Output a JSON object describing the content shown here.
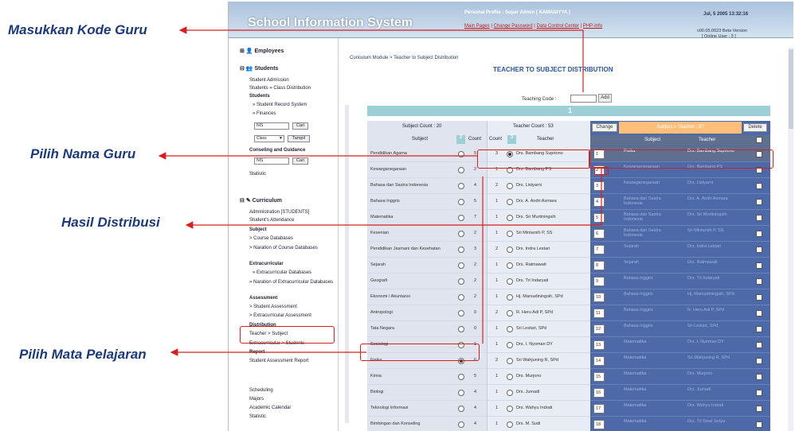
{
  "annotations": {
    "kode_guru": "Masukkan Kode Guru",
    "nama_guru": "Pilih Nama Guru",
    "hasil": "Hasil Distribusi",
    "mapel": "Pilih Mata Pelajaran"
  },
  "header": {
    "title": "School Information System",
    "profile": "Personal Profile : Super Admin [ KAMADIYYA ]",
    "links": [
      "Main Pages",
      "Change Password",
      "Data Control Center",
      "PHP-Info"
    ],
    "clock": "Jul, 5 2005 13:32:16",
    "version": "v00.05.0623 Beta Version",
    "online": "[ Online User : 3 ]"
  },
  "sidebar": {
    "employees": "Employees",
    "students": "Students",
    "student_admission": "Student Admission",
    "class_distribution": "Students » Class Distribution",
    "students_sub": "Students",
    "record_system": "» Student Record System",
    "finances": "» Finances",
    "nis1": "NIS",
    "cari1": "Cari",
    "class_sel": "Class",
    "tampil": "Tampil",
    "conseling": "Conseling and Guidance",
    "nis2": "NIS",
    "cari2": "Cari",
    "statistic": "Statistic",
    "curriculum": "Curriculum",
    "administration": "Administration [STUDENTS]",
    "attendance": "Student's Attendance",
    "subject": "Subject",
    "course_db": "> Course Databases",
    "narration_course": "> Naration of Course Databases",
    "extracurricular": "Extracurricular",
    "extra_db": "» Extracurricular Databases",
    "narration_extra": "» Naration of Extracurricular Databases",
    "assessment": "Assessment",
    "student_assessment": "> Student Assessment",
    "extra_assessment": "> Extracurricular Assessment",
    "distribution": "Distribution",
    "teacher_subject": "Teacher > Subject",
    "extra_students": "Extracurricular > Students",
    "report": "Report",
    "assessment_report": "Student Assessment Report",
    "scheduling": "Scheduling",
    "majors": "Majors",
    "academic_calendar": "Academic Calendar",
    "statistic2": "Statistic"
  },
  "main": {
    "breadcrumb": "Curiculum Module > Teacher to Subject Distribution",
    "page_title": "TEACHER TO SUBJECT DISTRIBUTION",
    "teaching_code_label": "Teaching Code :",
    "add_label": "Add",
    "band_number": "1",
    "subject_count": "Subject Count : 20",
    "teacher_count": "Teacher Count : 53",
    "col_subject": "Subject",
    "col_count": "Count",
    "col_teacher": "Teacher",
    "step2": "2",
    "step3": "3",
    "change_label": "Change",
    "dist_header": "Subject » Teacher : 87",
    "delete_label": "Delete",
    "dist_col_subject": "Subject",
    "dist_col_teacher": "Teacher"
  },
  "subjects": [
    {
      "name": "Pendidikan Agama",
      "count": "5"
    },
    {
      "name": "Kewarganegaraan",
      "count": "2"
    },
    {
      "name": "Bahasa dan Sastra Indonesia",
      "count": "4"
    },
    {
      "name": "Bahasa Inggris",
      "count": "5"
    },
    {
      "name": "Matematika",
      "count": "7"
    },
    {
      "name": "Kesenian",
      "count": "2"
    },
    {
      "name": "Pendidikan Jasmani dan Kesehatan",
      "count": "3"
    },
    {
      "name": "Sejarah",
      "count": "2"
    },
    {
      "name": "Geografi",
      "count": "2"
    },
    {
      "name": "Ekonomi / Akuntansi",
      "count": "2"
    },
    {
      "name": "Antropologi",
      "count": "0"
    },
    {
      "name": "Tata Negara",
      "count": "0"
    },
    {
      "name": "Sosiologi",
      "count": "1"
    },
    {
      "name": "Fisika",
      "count": "6"
    },
    {
      "name": "Kimia",
      "count": "5"
    },
    {
      "name": "Biologi",
      "count": "4"
    },
    {
      "name": "Teknologi Informasi",
      "count": "4"
    },
    {
      "name": "Bimbingan dan Konseling",
      "count": "4"
    },
    {
      "name": "Bahasa Jepang",
      "count": "1"
    }
  ],
  "teachers": [
    {
      "count": "3",
      "name": "Drs. Bambang Supriono"
    },
    {
      "count": "1",
      "name": "Drs. Bambang PS"
    },
    {
      "count": "2",
      "name": "Drs. Listyarni"
    },
    {
      "count": "1",
      "name": "Drs. A. Andri Asmara"
    },
    {
      "count": "1",
      "name": "Drs. Sri Murtiningsih"
    },
    {
      "count": "1",
      "name": "Sri Mintarsih P, SS"
    },
    {
      "count": "2",
      "name": "Drs. Indra Lestari"
    },
    {
      "count": "1",
      "name": "Drs. Ratmawati"
    },
    {
      "count": "1",
      "name": "Drs. Tri Indaryati"
    },
    {
      "count": "1",
      "name": "Hj. Marsudiningsih, SPd"
    },
    {
      "count": "2",
      "name": "R. Heru Adi P, SPd"
    },
    {
      "count": "1",
      "name": "Sri Lestari, SPd"
    },
    {
      "count": "1",
      "name": "Drs. I. Nyoman DY"
    },
    {
      "count": "2",
      "name": "Sri Wahjuning R, SPd"
    },
    {
      "count": "1",
      "name": "Drs. Murjono"
    },
    {
      "count": "1",
      "name": "Drs. Jumadi"
    },
    {
      "count": "1",
      "name": "Drs. Wahyu Indrati"
    },
    {
      "count": "1",
      "name": "Drs. M. Sudi"
    },
    {
      "count": "1",
      "name": "Drs. Rahadiya"
    }
  ],
  "distribution": [
    {
      "no": "1",
      "subject": "Fisika",
      "teacher": "Drs. Bambang Supriono"
    },
    {
      "no": "2",
      "subject": "Kewarganegaraan",
      "teacher": "Drs. Bambang PS"
    },
    {
      "no": "3",
      "subject": "Kewarganegaraan",
      "teacher": "Drs. Listyarni"
    },
    {
      "no": "4",
      "subject": "Bahasa dan Sastra Indonesia",
      "teacher": "Drs. A. Andri Asmara"
    },
    {
      "no": "5",
      "subject": "Bahasa dan Sastra Indonesia",
      "teacher": "Drs. Sri Murtiningsih"
    },
    {
      "no": "6",
      "subject": "Bahasa dan Sastra Indonesia",
      "teacher": "Sri Mintarsih P, SS"
    },
    {
      "no": "7",
      "subject": "Sejarah",
      "teacher": "Drs. Indra Lestari"
    },
    {
      "no": "8",
      "subject": "Sejarah",
      "teacher": "Drs. Ratmawati"
    },
    {
      "no": "9",
      "subject": "Bahasa Inggris",
      "teacher": "Drs. Tri Indaryati"
    },
    {
      "no": "10",
      "subject": "Bahasa Inggris",
      "teacher": "Hj. Marsudiningsih, SPd"
    },
    {
      "no": "11",
      "subject": "Bahasa Inggris",
      "teacher": "R. Heru Adi P, SPd"
    },
    {
      "no": "12",
      "subject": "Bahasa Inggris",
      "teacher": "Sri Lestari, SPd"
    },
    {
      "no": "13",
      "subject": "Matematika",
      "teacher": "Drs. I. Nyoman DY"
    },
    {
      "no": "14",
      "subject": "Matematika",
      "teacher": "Sri Wahjuning R, SPd"
    },
    {
      "no": "15",
      "subject": "Matematika",
      "teacher": "Drs. Murjono"
    },
    {
      "no": "16",
      "subject": "Matematika",
      "teacher": "Drs. Jumadi"
    },
    {
      "no": "17",
      "subject": "Matematika",
      "teacher": "Drs. Wahyu Indrati"
    },
    {
      "no": "18",
      "subject": "Matematika",
      "teacher": "Drs. Tri Dewi Setya"
    }
  ],
  "colors": {
    "accent": "#2a55a0",
    "annotation": "#1c3a7a",
    "highlight": "#d62020",
    "dist_bg": "#4d69a8",
    "selected": "#5f6f8f"
  }
}
